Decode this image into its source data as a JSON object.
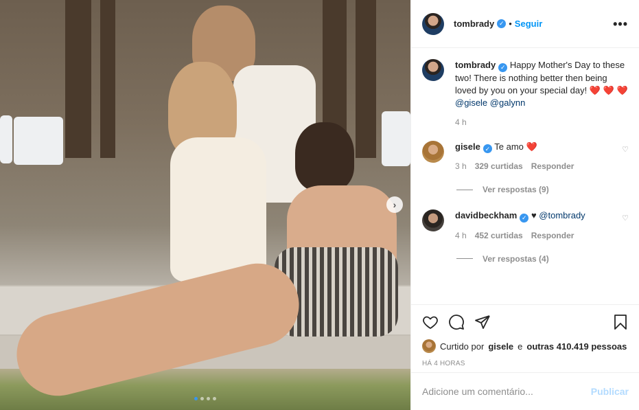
{
  "post": {
    "author": "tombrady",
    "follow_label": "Seguir",
    "more_icon": "more-options-icon"
  },
  "caption": {
    "username": "tombrady",
    "text": "Happy Mother's Day to these two! There is nothing better then being loved by you on your special day!",
    "hearts": "❤️ ❤️ ❤️",
    "mention1": "@gisele",
    "mention2": "@galynn",
    "time": "4 h"
  },
  "comments": [
    {
      "username": "gisele",
      "text": "Te amo",
      "emoji": "❤️",
      "time": "3 h",
      "likes": "329 curtidas",
      "reply_label": "Responder",
      "view_replies": "Ver respostas (9)"
    },
    {
      "username": "davidbeckham",
      "text": "♥",
      "mention": "@tombrady",
      "time": "4 h",
      "likes": "452 curtidas",
      "reply_label": "Responder",
      "view_replies": "Ver respostas (4)"
    }
  ],
  "likes": {
    "prefix": "Curtido por",
    "liker": "gisele",
    "joiner": "e",
    "others": "outras 410.419 pessoas"
  },
  "timestamp": "HÁ 4 HORAS",
  "add_comment": {
    "placeholder": "Adicione um comentário...",
    "post_label": "Publicar"
  },
  "carousel": {
    "slide_count": 4,
    "active_slide": 1
  },
  "colors": {
    "link_blue": "#0095f6",
    "verified": "#3897f0",
    "heart_red": "#ed4956",
    "muted": "#8e8e8e"
  }
}
